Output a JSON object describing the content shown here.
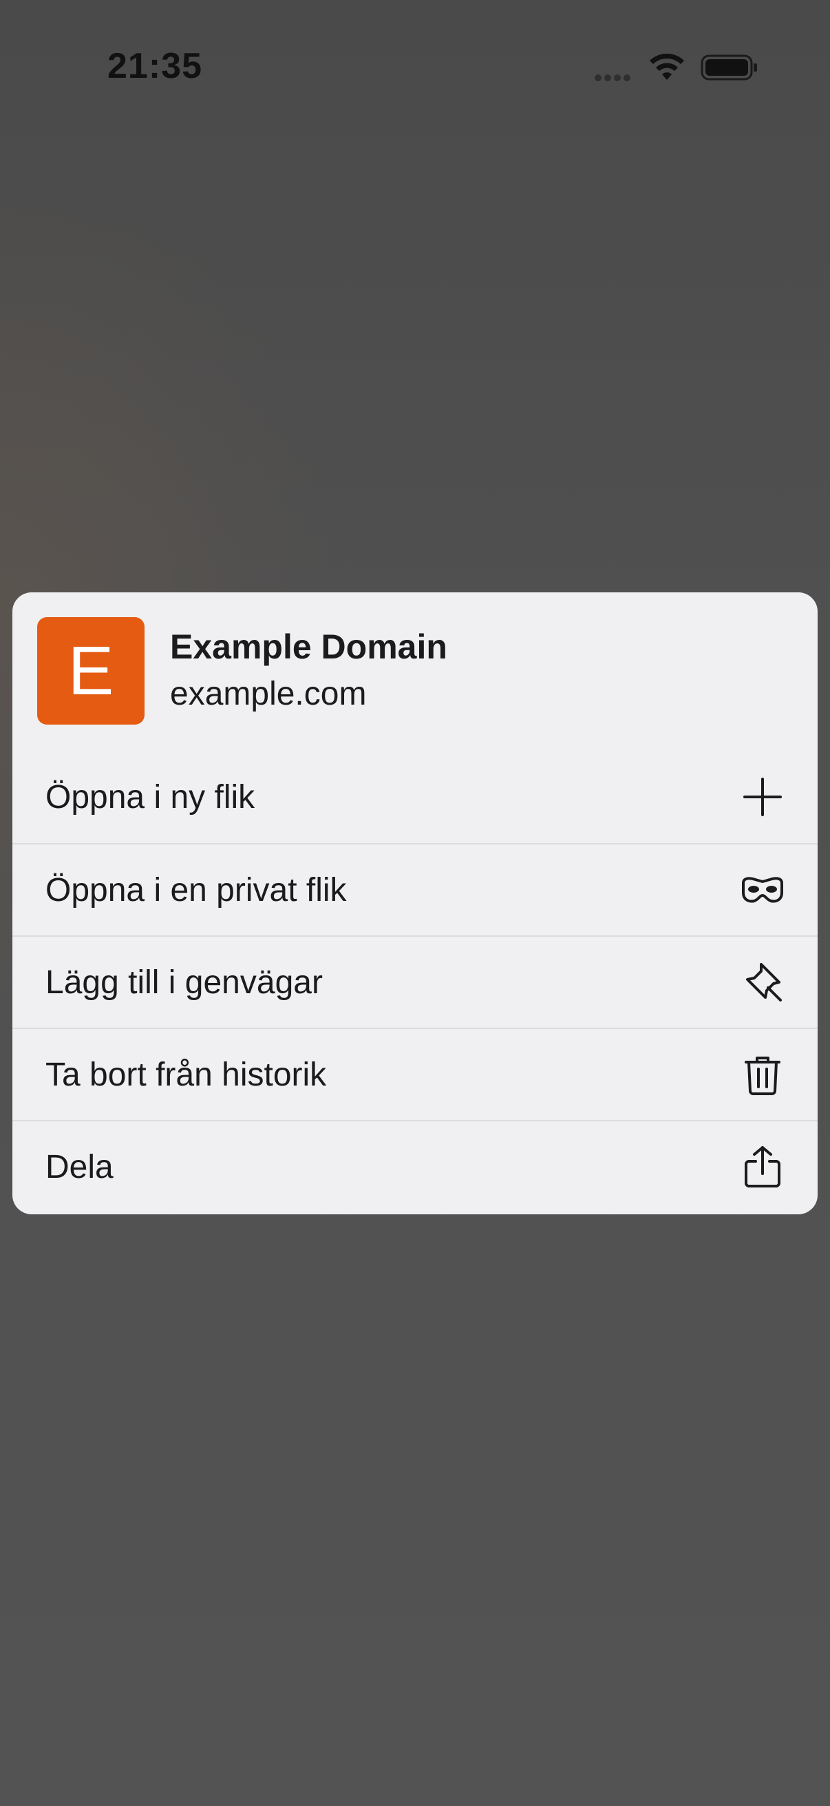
{
  "status_bar": {
    "time": "21:35"
  },
  "preview": {
    "favicon_letter": "E",
    "favicon_color": "#e55b12",
    "title": "Example Domain",
    "url": "example.com"
  },
  "menu": {
    "items": [
      {
        "label": "Öppna i ny flik",
        "icon": "plus-icon"
      },
      {
        "label": "Öppna i en privat flik",
        "icon": "private-mask-icon"
      },
      {
        "label": "Lägg till i genvägar",
        "icon": "pin-icon"
      },
      {
        "label": "Ta bort från historik",
        "icon": "trash-icon"
      },
      {
        "label": "Dela",
        "icon": "share-icon"
      }
    ]
  }
}
